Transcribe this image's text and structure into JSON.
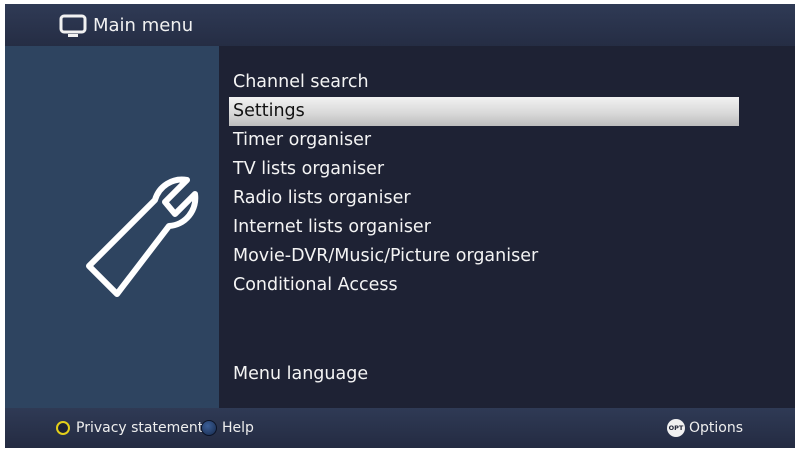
{
  "header": {
    "title": "Main menu",
    "icon": "tv-icon"
  },
  "left_panel": {
    "icon": "wrench-icon"
  },
  "menu": {
    "items": [
      {
        "label": "Channel search",
        "selected": false
      },
      {
        "label": "Settings",
        "selected": true
      },
      {
        "label": "Timer organiser",
        "selected": false
      },
      {
        "label": "TV lists organiser",
        "selected": false
      },
      {
        "label": "Radio lists organiser",
        "selected": false
      },
      {
        "label": "Internet lists organiser",
        "selected": false
      },
      {
        "label": "Movie-DVR/Music/Picture organiser",
        "selected": false
      },
      {
        "label": "Conditional Access",
        "selected": false
      }
    ],
    "language_label": "Menu language"
  },
  "footer": {
    "privacy_label": "Privacy statement",
    "help_label": "Help",
    "options_badge": "OPT",
    "options_label": "Options"
  },
  "colors": {
    "background": "#1e2234",
    "left_panel": "#2e4460",
    "highlight": "#d9d9d9",
    "yellow_key": "#e3cf1a",
    "blue_key": "#3c5f97"
  }
}
